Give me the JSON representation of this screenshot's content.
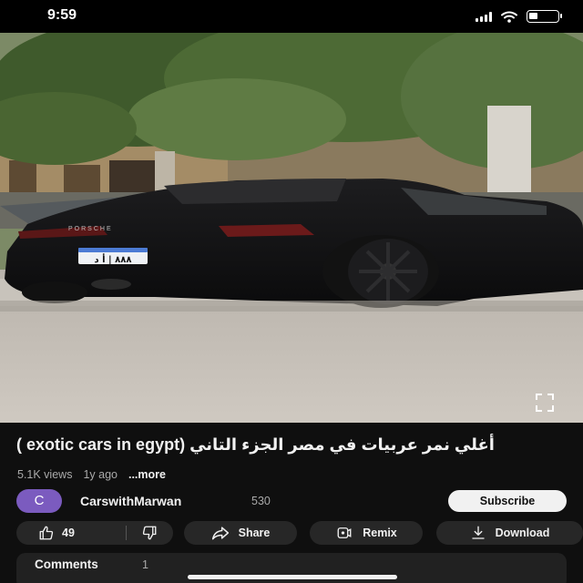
{
  "status_bar": {
    "time": "9:59"
  },
  "video": {
    "plate_text": "٨٨٨ | أ د"
  },
  "title": "أغلي نمر عربيات في مصر الجزء التاني (exotic cars in egypt )",
  "meta": {
    "views": "5.1K views",
    "age": "1y ago",
    "more": "...more"
  },
  "channel": {
    "avatar_letter": "C",
    "name": "CarswithMarwan",
    "subscribers": "530",
    "subscribe_label": "Subscribe"
  },
  "actions": {
    "likes": "49",
    "share": "Share",
    "remix": "Remix",
    "download": "Download"
  },
  "comments": {
    "label": "Comments",
    "count": "1"
  },
  "colors": {
    "background": "#0f0f0f",
    "pill": "#272727",
    "avatar": "#7b5bbf",
    "subscribe_bg": "#f1f1f1"
  }
}
